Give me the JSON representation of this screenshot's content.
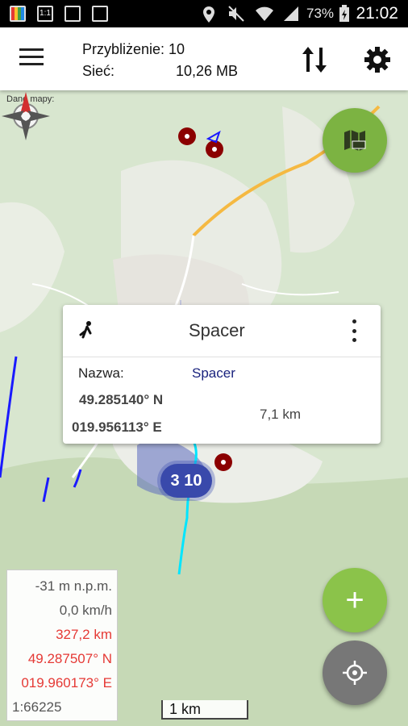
{
  "status_bar": {
    "battery": "73%",
    "time": "21:02",
    "icons": [
      "gallery-icon",
      "one-to-one-icon",
      "image-icon",
      "screen-icon",
      "location-icon",
      "mute-icon",
      "wifi-icon",
      "signal-icon",
      "battery-charging-icon"
    ]
  },
  "toolbar": {
    "zoom_text": "Przybliżenie: 10",
    "network_label": "Sieć:",
    "network_value": "10,26 MB",
    "icons": [
      "menu-icon",
      "sort-arrows-icon",
      "settings-gear-icon"
    ]
  },
  "map": {
    "data_label": "Dane mapy:",
    "cluster_count": "3 10",
    "scale_bar": "1 km",
    "colors": {
      "track": "#00e5ff",
      "route": "#1a1aff",
      "cluster": "#3949ab",
      "poi": "#8b0000",
      "road": "#f5b942"
    }
  },
  "popup": {
    "title": "Spacer",
    "name_label": "Nazwa:",
    "name_value": "Spacer",
    "latitude": "49.285140° N",
    "longitude": "019.956113° E",
    "distance": "7,1 km",
    "icons": [
      "walking-track-icon",
      "more-vert-icon"
    ]
  },
  "info_panel": {
    "altitude": "-31 m n.p.m.",
    "speed": "0,0 km/h",
    "distance": "327,2 km",
    "latitude": "49.287507° N",
    "longitude": "019.960173° E",
    "scale": "1:66225"
  },
  "fabs": {
    "record_icon": "record-map-icon",
    "add_label": "+",
    "locate_icon": "gps-target-icon"
  }
}
